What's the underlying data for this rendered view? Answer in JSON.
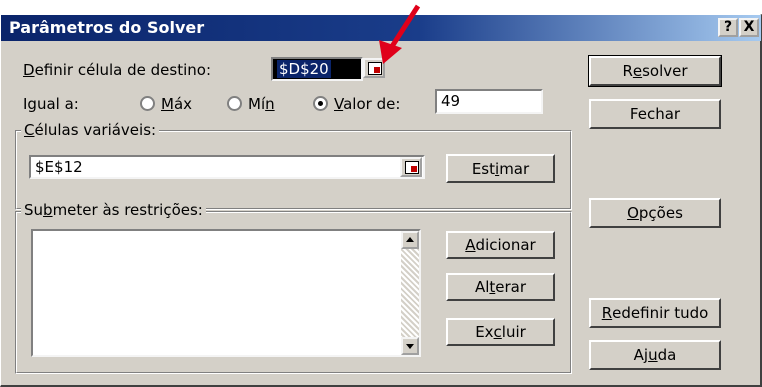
{
  "window": {
    "title": "Parâmetros do Solver",
    "help_glyph": "?",
    "close_glyph": "X"
  },
  "target": {
    "label_pre": "",
    "label_ul": "D",
    "label_post": "efinir célula de destino:",
    "value": "$D$20"
  },
  "equal_to": {
    "label": "Igual a:",
    "max_ul": "M",
    "max_post": "áx",
    "min_pre": "Mí",
    "min_ul": "n",
    "value_ul": "V",
    "value_post": "alor de:",
    "selected": "valor",
    "value_input": "49"
  },
  "variable_cells": {
    "label_ul": "C",
    "label_post": "élulas variáveis:",
    "value": "$E$12",
    "estimate_pre": "Est",
    "estimate_ul": "i",
    "estimate_post": "mar"
  },
  "constraints": {
    "label_pre": "Su",
    "label_ul": "b",
    "label_post": "meter às restrições:",
    "items": [],
    "add_ul": "A",
    "add_post": "dicionar",
    "change_pre": "Al",
    "change_ul": "t",
    "change_post": "erar",
    "delete_pre": "Ex",
    "delete_ul": "c",
    "delete_post": "luir"
  },
  "buttons": {
    "solve_pre": "R",
    "solve_ul": "e",
    "solve_post": "solver",
    "close": "Fechar",
    "options_ul": "O",
    "options_post": "pções",
    "reset_ul": "R",
    "reset_post": "edefinir tudo",
    "help_pre": "Aj",
    "help_ul": "u",
    "help_post": "da"
  },
  "annotation": {
    "arrow_color": "#e0001a"
  },
  "colors": {
    "titlebar": "#0a246a",
    "face": "#d4d0c8",
    "selection": "#0a246a"
  }
}
